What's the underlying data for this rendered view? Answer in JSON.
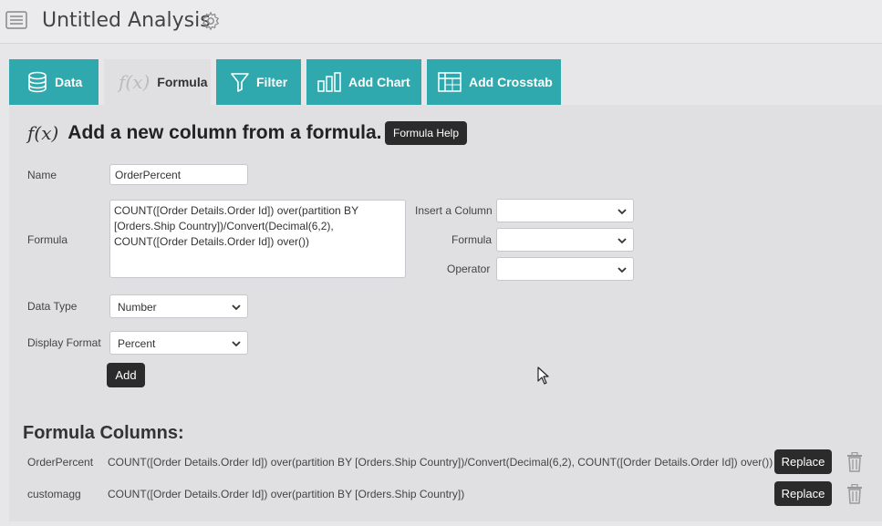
{
  "header": {
    "title": "Untitled Analysis"
  },
  "tabs": [
    {
      "label": "Data",
      "icon": "database-icon",
      "active": false
    },
    {
      "label": "Formula",
      "icon": "function-icon",
      "active": true
    },
    {
      "label": "Filter",
      "icon": "filter-icon",
      "active": false
    },
    {
      "label": "Add Chart",
      "icon": "bar-chart-icon",
      "active": false
    },
    {
      "label": "Add Crosstab",
      "icon": "table-icon",
      "active": false
    }
  ],
  "form": {
    "heading_symbol": "f(x)",
    "heading": "Add a new column from a formula.",
    "help_label": "Formula Help",
    "name_label": "Name",
    "name_value": "OrderPercent",
    "formula_label": "Formula",
    "formula_value": "COUNT([Order Details.Order Id]) over(partition BY [Orders.Ship Country])/Convert(Decimal(6,2), COUNT([Order Details.Order Id]) over())",
    "insert_column_label": "Insert a Column",
    "insert_column_value": "",
    "formula_select_label": "Formula",
    "formula_select_value": "",
    "operator_label": "Operator",
    "operator_value": "",
    "data_type_label": "Data Type",
    "data_type_value": "Number",
    "display_format_label": "Display Format",
    "display_format_value": "Percent",
    "add_label": "Add"
  },
  "formula_columns": {
    "title": "Formula Columns:",
    "replace_label": "Replace",
    "rows": [
      {
        "name": "OrderPercent",
        "formula": "COUNT([Order Details.Order Id]) over(partition BY [Orders.Ship Country])/Convert(Decimal(6,2), COUNT([Order Details.Order Id]) over())"
      },
      {
        "name": "customagg",
        "formula": "COUNT([Order Details.Order Id]) over(partition BY [Orders.Ship Country])"
      }
    ]
  },
  "colors": {
    "accent": "#2fa9ae",
    "dark_button": "#2b2b2b",
    "panel": "#e0e0e3"
  }
}
